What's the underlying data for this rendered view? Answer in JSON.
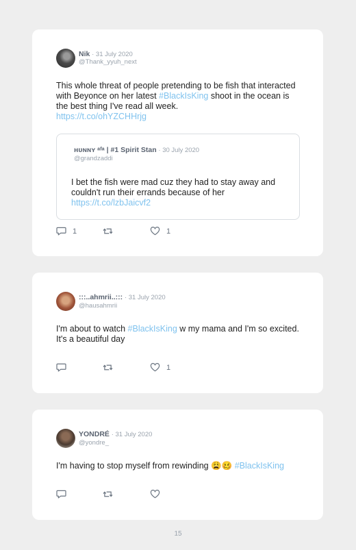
{
  "tweets": [
    {
      "name": "Nik",
      "date": "· 31 July 2020",
      "handle": "@Thank_yyuh_next",
      "text_before": "This whole threat of people pretending to be fish that interacted with Beyonce on her latest ",
      "hashtag": "#BlackIsKing",
      "text_after": " shoot in the ocean is the best thing I've read all week.",
      "link": "https://t.co/ohYZCHHrjg",
      "quote": {
        "name": "ʜᴜɴɴʏ ᵃᶠᵃ | #1 Spirit Stan",
        "date": "· 30 July 2020",
        "handle": "@grandzaddi",
        "text": "I bet the fish were mad cuz they had to stay away and couldn't run their errands because of her",
        "link": "https://t.co/lzbJaicvf2"
      },
      "replies": "1",
      "likes": "1"
    },
    {
      "name": ":::..ahmrii..:::",
      "date": "· 31 July 2020",
      "handle": "@hausahmrii",
      "text_before": "I'm about to watch ",
      "hashtag": "#BlackIsKing",
      "text_after": " w my mama and I'm so excited. It's a beautiful day",
      "likes": "1"
    },
    {
      "name": "YONDRÉ",
      "date": "· 31 July 2020",
      "handle": "@yondre_",
      "text_before": "I'm having to stop myself from rewinding ",
      "emoji": "😩🥴",
      "hashtag": "#BlackIsKing"
    }
  ],
  "icons": [
    "reply-icon",
    "retweet-icon",
    "like-icon"
  ],
  "page_number": "15"
}
